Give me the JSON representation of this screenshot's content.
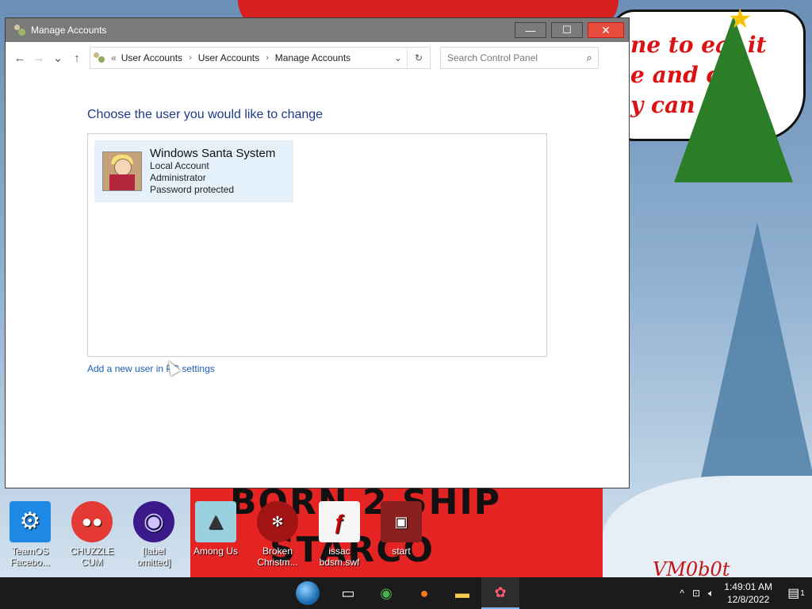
{
  "window": {
    "title": "Manage Accounts",
    "minimize_glyph": "—",
    "maximize_glyph": "☐",
    "close_glyph": "✕"
  },
  "nav": {
    "back_glyph": "←",
    "forward_glyph": "→",
    "recent_glyph": "⌄",
    "up_glyph": "↑"
  },
  "address": {
    "overflow": "«",
    "crumbs": [
      "User Accounts",
      "User Accounts",
      "Manage Accounts"
    ],
    "separator": "›",
    "dropdown_glyph": "⌄",
    "refresh_glyph": "↻"
  },
  "search": {
    "placeholder": "Search Control Panel",
    "icon": "search-icon"
  },
  "main": {
    "heading": "Choose the user you would like to change",
    "accounts": [
      {
        "name": "Windows Santa System",
        "type": "Local Account",
        "role": "Administrator",
        "security": "Password protected"
      }
    ],
    "add_user_link": "Add a new user in PC settings"
  },
  "wallpaper": {
    "speech_line1": "ne to eat it",
    "speech_line2": "e and c",
    "speech_line3": "y can",
    "banner_line1": "BORN 2 SHIP",
    "banner_line2": "STARCO",
    "watermark": "VM0b0t"
  },
  "desktop_icons": [
    {
      "label_1": "TeamOS",
      "label_2": "Facebo...",
      "icon": "settings-gear-icon"
    },
    {
      "label_1": "CHUZZLE",
      "label_2": "CUM",
      "icon": "chuzzle-icon"
    },
    {
      "label_1": "[label",
      "label_2": "omitted]",
      "icon": "disc-icon"
    },
    {
      "label_1": "Among Us",
      "label_2": "",
      "icon": "among-us-icon"
    },
    {
      "label_1": "Broken",
      "label_2": "Christm...",
      "icon": "christmas-ornament-icon"
    },
    {
      "label_1": "issac",
      "label_2": "bdsm.swf",
      "icon": "flash-file-icon"
    },
    {
      "label_1": "start",
      "label_2": "",
      "icon": "start-app-icon"
    }
  ],
  "taskbar": {
    "apps": [
      "task-view-icon",
      "chrome-icon",
      "firefox-icon",
      "file-explorer-icon",
      "control-panel-icon"
    ],
    "tray_chevron": "^",
    "time": "1:49:01 AM",
    "date": "12/8/2022",
    "notification_count": "1"
  }
}
